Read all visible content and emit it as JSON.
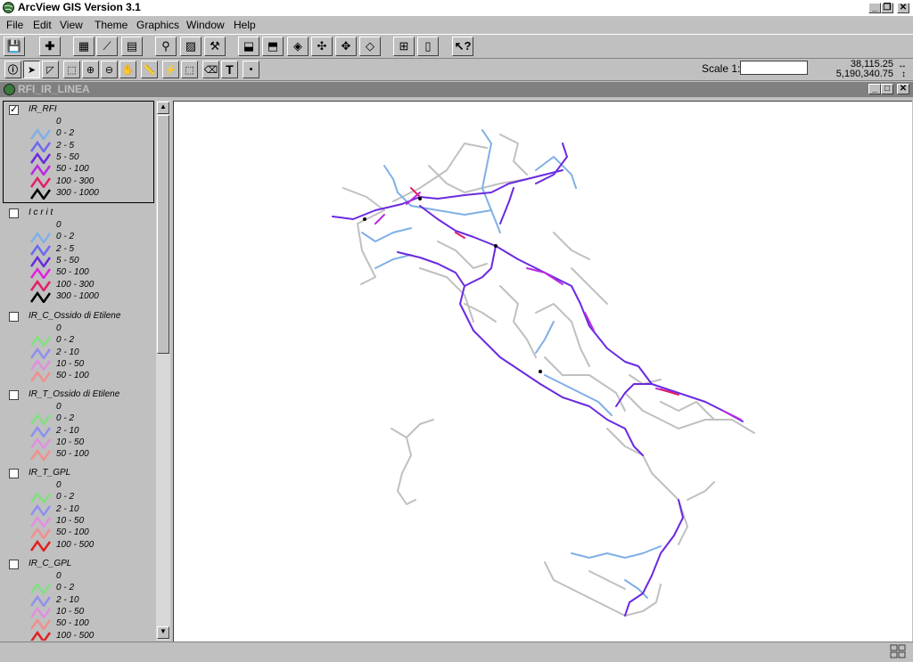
{
  "app": {
    "title": "ArcView GIS Version 3.1"
  },
  "menus": [
    "File",
    "Edit",
    "View",
    "Theme",
    "Graphics",
    "Window",
    "Help"
  ],
  "toolbar1": {
    "icons": [
      "save-icon",
      "add-theme-icon",
      "theme-properties-icon",
      "edit-legend-icon",
      "open-table-icon",
      "find-icon",
      "locate-icon",
      "query-builder-icon",
      "select-by-theme-icon",
      "select-all-icon",
      "zoom-full-extent-icon",
      "zoom-active-themes-icon",
      "zoom-selected-icon",
      "zoom-in-fixed-icon",
      "zoom-out-fixed-icon",
      "layout-icon",
      "help-icon"
    ]
  },
  "toolbar2": {
    "icons": [
      "identify-icon",
      "pointer-icon",
      "vertex-edit-icon",
      "select-feature-icon",
      "zoom-in-icon",
      "zoom-out-icon",
      "pan-icon",
      "measure-icon",
      "hotlink-icon",
      "area-of-interest-icon",
      "label-icon",
      "text-icon",
      "draw-point-icon"
    ]
  },
  "scale": {
    "label": "Scale 1:",
    "value": ""
  },
  "coords": {
    "x": "38,115.25",
    "y": "5,190,340.75"
  },
  "view": {
    "title": "RFI_IR_LINEA"
  },
  "themes": [
    {
      "name": "IR_RFI",
      "checked": true,
      "classes": [
        {
          "label": "0",
          "color": "#c0c0c0"
        },
        {
          "label": "0 - 2",
          "color": "#7fb0e6"
        },
        {
          "label": "2 - 5",
          "color": "#6a6af0"
        },
        {
          "label": "5 - 50",
          "color": "#6a2ae0"
        },
        {
          "label": "50 - 100",
          "color": "#b82ae0"
        },
        {
          "label": "100 - 300",
          "color": "#e0206a"
        },
        {
          "label": "300 - 1000",
          "color": "#000000"
        }
      ]
    },
    {
      "name": "I c r i t",
      "checked": false,
      "classes": [
        {
          "label": "0",
          "color": "#c0c0c0"
        },
        {
          "label": "0 - 2",
          "color": "#7fb0e6"
        },
        {
          "label": "2 - 5",
          "color": "#6a6af0"
        },
        {
          "label": "5 - 50",
          "color": "#6a2ae0"
        },
        {
          "label": "50 - 100",
          "color": "#e020e0"
        },
        {
          "label": "100 - 300",
          "color": "#e0206a"
        },
        {
          "label": "300 - 1000",
          "color": "#000000"
        }
      ]
    },
    {
      "name": "IR_C_Ossido di Etilene",
      "checked": false,
      "classes": [
        {
          "label": "0",
          "color": "#c0c0c0"
        },
        {
          "label": "0 - 2",
          "color": "#80e080"
        },
        {
          "label": "2 - 10",
          "color": "#9090f0"
        },
        {
          "label": "10 - 50",
          "color": "#e090e0"
        },
        {
          "label": "50 - 100",
          "color": "#f09090"
        }
      ]
    },
    {
      "name": "IR_T_Ossido di Etilene",
      "checked": false,
      "classes": [
        {
          "label": "0",
          "color": "#c0c0c0"
        },
        {
          "label": "0 - 2",
          "color": "#80e080"
        },
        {
          "label": "2 - 10",
          "color": "#9090f0"
        },
        {
          "label": "10 - 50",
          "color": "#e090e0"
        },
        {
          "label": "50 - 100",
          "color": "#f09090"
        }
      ]
    },
    {
      "name": "IR_T_GPL",
      "checked": false,
      "classes": [
        {
          "label": "0",
          "color": "#c0c0c0"
        },
        {
          "label": "0 - 2",
          "color": "#80e080"
        },
        {
          "label": "2 - 10",
          "color": "#9090f0"
        },
        {
          "label": "10 - 50",
          "color": "#e090e0"
        },
        {
          "label": "50 - 100",
          "color": "#f09090"
        },
        {
          "label": "100 - 500",
          "color": "#e02020"
        }
      ]
    },
    {
      "name": "IR_C_GPL",
      "checked": false,
      "classes": [
        {
          "label": "0",
          "color": "#c0c0c0"
        },
        {
          "label": "0 - 2",
          "color": "#80e080"
        },
        {
          "label": "2 - 10",
          "color": "#9090f0"
        },
        {
          "label": "10 - 50",
          "color": "#e090e0"
        },
        {
          "label": "50 - 100",
          "color": "#f09090"
        },
        {
          "label": "100 - 500",
          "color": "#e02020"
        }
      ]
    }
  ]
}
